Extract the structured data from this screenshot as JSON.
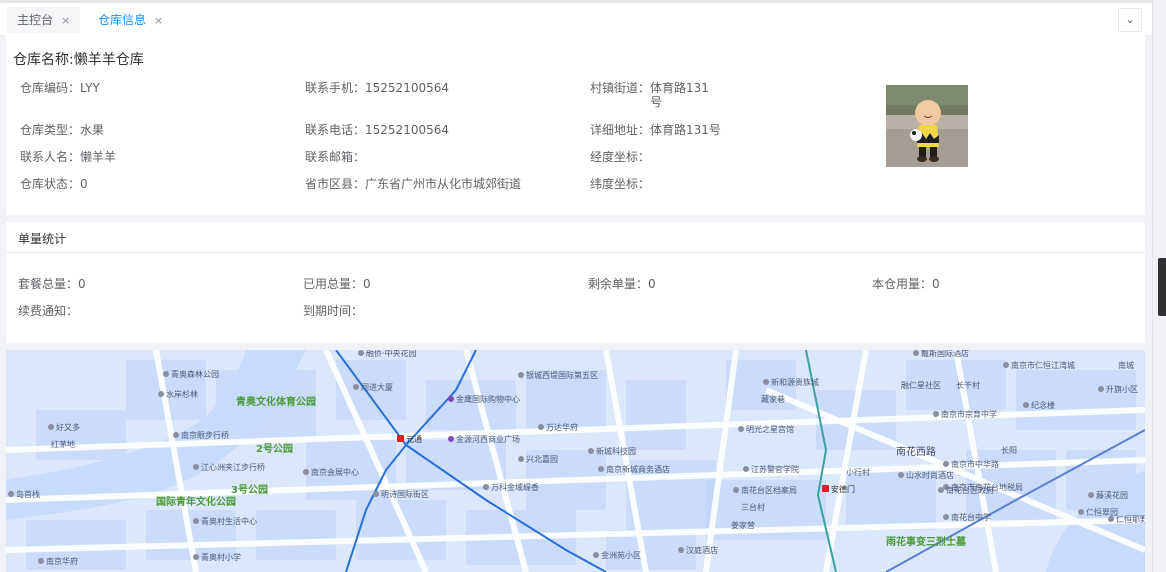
{
  "tabs": [
    {
      "label": "主控台",
      "active": false
    },
    {
      "label": "仓库信息",
      "active": true
    }
  ],
  "tab_close": "×",
  "tab_dropdown": "⌄",
  "warehouse": {
    "title": "仓库名称:懒羊羊仓库",
    "code": {
      "label": "仓库编码：",
      "value": "LYY"
    },
    "type": {
      "label": "仓库类型：",
      "value": "水果"
    },
    "contact_name": {
      "label": "联系人名：",
      "value": "懒羊羊"
    },
    "status": {
      "label": "仓库状态：",
      "value": "0"
    },
    "mobile": {
      "label": "联系手机：",
      "value": "15252100564"
    },
    "phone": {
      "label": "联系电话：",
      "value": "15252100564"
    },
    "email": {
      "label": "联系邮箱：",
      "value": ""
    },
    "region": {
      "label": "省市区县：",
      "value": "广东省广州市从化市城郊街道"
    },
    "street": {
      "label": "村镇街道：",
      "value": "体育路131号"
    },
    "address": {
      "label": "详细地址：",
      "value": "体育路131号"
    },
    "longitude": {
      "label": "经度坐标：",
      "value": ""
    },
    "latitude": {
      "label": "纬度坐标：",
      "value": ""
    }
  },
  "stats": {
    "title": "单量统计",
    "package_total": {
      "label": "套餐总量：",
      "value": "0"
    },
    "used_total": {
      "label": "已用总量：",
      "value": "0"
    },
    "remaining": {
      "label": "剩余单量：",
      "value": "0"
    },
    "warehouse_used": {
      "label": "本仓用量：",
      "value": "0"
    },
    "renewal_notice": {
      "label": "续费通知：",
      "value": ""
    },
    "expire_time": {
      "label": "到期时间：",
      "value": ""
    }
  },
  "map": {
    "labels": [
      {
        "text": "融侨·中央花园",
        "kind": "poi"
      },
      {
        "text": "戴斯国际酒店",
        "kind": "poi"
      },
      {
        "text": "青奥森林公园",
        "kind": "poi"
      },
      {
        "text": "同进大厦",
        "kind": "poi"
      },
      {
        "text": "银城西堤国际第五区",
        "kind": "poi"
      },
      {
        "text": "新和源贵族城",
        "kind": "poi"
      },
      {
        "text": "南京市仁恒江湾城",
        "kind": "poi"
      },
      {
        "text": "南城",
        "kind": "area"
      },
      {
        "text": "水岸杉林",
        "kind": "poi"
      },
      {
        "text": "青奥文化体育公园",
        "kind": "park"
      },
      {
        "text": "金鹰国际购物中心",
        "kind": "mall"
      },
      {
        "text": "藏家巷",
        "kind": "area"
      },
      {
        "text": "融仁星社区",
        "kind": "area"
      },
      {
        "text": "长干村",
        "kind": "area"
      },
      {
        "text": "升旗小区",
        "kind": "poi"
      },
      {
        "text": "南京市宗育中学",
        "kind": "poi"
      },
      {
        "text": "好又多",
        "kind": "poi"
      },
      {
        "text": "南京眼步行桥",
        "kind": "poi"
      },
      {
        "text": "金源河西商业广场",
        "kind": "mall"
      },
      {
        "text": "万达华府",
        "kind": "poi"
      },
      {
        "text": "明光之星宫馆",
        "kind": "poi"
      },
      {
        "text": "纪念楼",
        "kind": "poi"
      },
      {
        "text": "红茅地",
        "kind": "area"
      },
      {
        "text": "2号公园",
        "kind": "park"
      },
      {
        "text": "元通",
        "kind": "metro"
      },
      {
        "text": "新城科技园",
        "kind": "poi"
      },
      {
        "text": "南花西路",
        "kind": "road"
      },
      {
        "text": "长阳",
        "kind": "area"
      },
      {
        "text": "南京市中华路",
        "kind": "poi"
      },
      {
        "text": "江心洲夹江步行桥",
        "kind": "poi"
      },
      {
        "text": "南京会展中心",
        "kind": "poi"
      },
      {
        "text": "兴北嘉园",
        "kind": "poi"
      },
      {
        "text": "南京新城商务酒店",
        "kind": "poi"
      },
      {
        "text": "江苏警官学院",
        "kind": "poi"
      },
      {
        "text": "小行村",
        "kind": "area"
      },
      {
        "text": "山水时尚酒店",
        "kind": "poi"
      },
      {
        "text": "南京市南花台地税局",
        "kind": "poi"
      },
      {
        "text": "岛首栈",
        "kind": "poi"
      },
      {
        "text": "3号公园",
        "kind": "park"
      },
      {
        "text": "明诗国际街区",
        "kind": "poi"
      },
      {
        "text": "万科金域缇香",
        "kind": "poi"
      },
      {
        "text": "南花台区档案局",
        "kind": "poi"
      },
      {
        "text": "三台村",
        "kind": "area"
      },
      {
        "text": "安德门",
        "kind": "metro"
      },
      {
        "text": "南花台区政府",
        "kind": "poi"
      },
      {
        "text": "藤溪花园",
        "kind": "poi"
      },
      {
        "text": "国际青年文化公园",
        "kind": "park"
      },
      {
        "text": "青奥村生活中心",
        "kind": "poi"
      },
      {
        "text": "姜家营",
        "kind": "area"
      },
      {
        "text": "南花台中学",
        "kind": "poi"
      },
      {
        "text": "仁恒翠园",
        "kind": "poi"
      },
      {
        "text": "仁恒耶野",
        "kind": "poi"
      },
      {
        "text": "青奥村小学",
        "kind": "poi"
      },
      {
        "text": "金洲苑小区",
        "kind": "poi"
      },
      {
        "text": "汉庭酒店",
        "kind": "poi"
      },
      {
        "text": "雨花事变三烈士墓",
        "kind": "park"
      },
      {
        "text": "南京华府",
        "kind": "poi"
      }
    ]
  },
  "colors": {
    "accent": "#1890ff",
    "map_bg": "#dbe7fa",
    "map_block": "#bcd3f7",
    "metro": "#e02020"
  }
}
